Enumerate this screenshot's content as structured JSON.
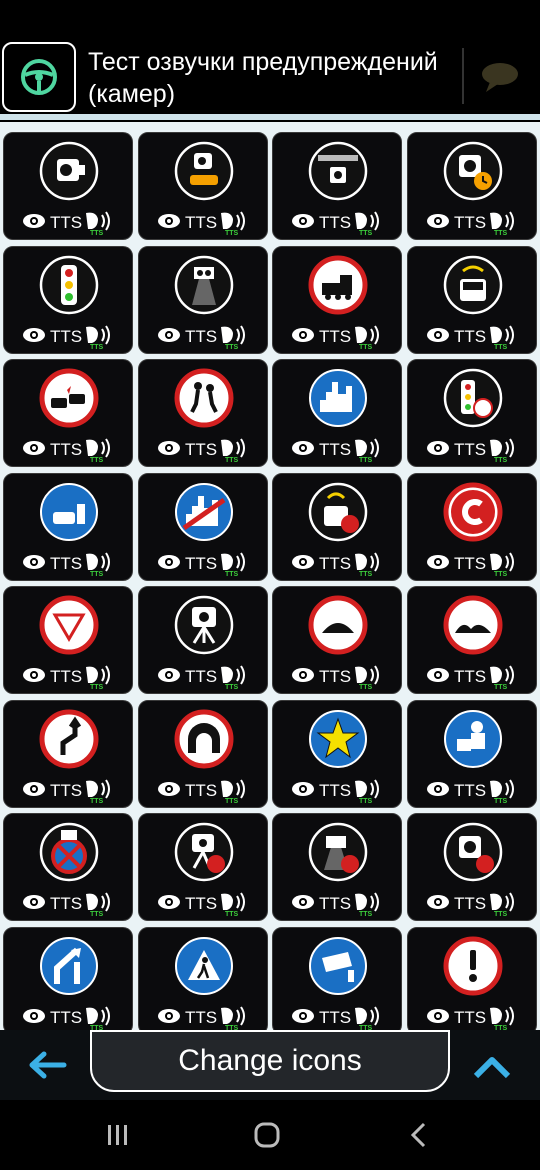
{
  "header": {
    "title": "Тест озвучки предупреждений (камер)",
    "logo_icon": "steering-wheel-icon",
    "chat_icon": "chat-bubble-icon"
  },
  "tile_labels": {
    "tts": "TTS",
    "tts_small": "TTS"
  },
  "tiles": [
    {
      "name": "speed-camera",
      "icon": "speed-camera-icon"
    },
    {
      "name": "car-speed-camera",
      "icon": "car-camera-icon"
    },
    {
      "name": "bridge-camera",
      "icon": "bridge-camera-icon"
    },
    {
      "name": "average-speed-camera",
      "icon": "camera-clock-icon"
    },
    {
      "name": "traffic-light",
      "icon": "traffic-light-icon"
    },
    {
      "name": "lane-camera",
      "icon": "lane-camera-icon"
    },
    {
      "name": "railway-crossing",
      "icon": "train-icon"
    },
    {
      "name": "bus-lane-camera",
      "icon": "bus-icon"
    },
    {
      "name": "accident",
      "icon": "crash-icon"
    },
    {
      "name": "children",
      "icon": "children-icon"
    },
    {
      "name": "city-start",
      "icon": "city-icon"
    },
    {
      "name": "traffic-light-speed",
      "icon": "traffic-light-speed-icon"
    },
    {
      "name": "parking-zone",
      "icon": "parking-car-icon"
    },
    {
      "name": "city-end",
      "icon": "city-end-icon"
    },
    {
      "name": "bus-lane-rear",
      "icon": "bus-camera-rear-icon"
    },
    {
      "name": "congestion-charge",
      "icon": "c-charge-icon"
    },
    {
      "name": "yield",
      "icon": "yield-icon"
    },
    {
      "name": "tripod-camera",
      "icon": "tripod-camera-icon"
    },
    {
      "name": "speed-bump",
      "icon": "speed-bump-icon"
    },
    {
      "name": "uneven-road",
      "icon": "uneven-road-icon"
    },
    {
      "name": "dangerous-curves",
      "icon": "curve-icon"
    },
    {
      "name": "tunnel",
      "icon": "tunnel-icon"
    },
    {
      "name": "favorite",
      "icon": "star-icon"
    },
    {
      "name": "police-post",
      "icon": "police-icon"
    },
    {
      "name": "no-parking-camera",
      "icon": "no-parking-icon"
    },
    {
      "name": "tripod-camera-rear",
      "icon": "tripod-rear-icon"
    },
    {
      "name": "lane-camera-rear",
      "icon": "lane-rear-icon"
    },
    {
      "name": "speed-camera-rear",
      "icon": "camera-rear-icon"
    },
    {
      "name": "merge",
      "icon": "merge-icon"
    },
    {
      "name": "pedestrian-crossing",
      "icon": "pedestrian-icon"
    },
    {
      "name": "cctv-camera",
      "icon": "cctv-icon"
    },
    {
      "name": "danger",
      "icon": "exclamation-icon"
    }
  ],
  "bottom": {
    "change_label": "Change icons",
    "back_icon": "arrow-left-icon",
    "up_icon": "chevron-up-icon"
  },
  "colors": {
    "accent": "#cfe3ea",
    "tile_bg": "#0b0b0d",
    "tts_green": "#3ccf3c",
    "blue_arrow": "#3bb0e6",
    "sign_red": "#d32020",
    "sign_blue": "#1a6fc4"
  }
}
